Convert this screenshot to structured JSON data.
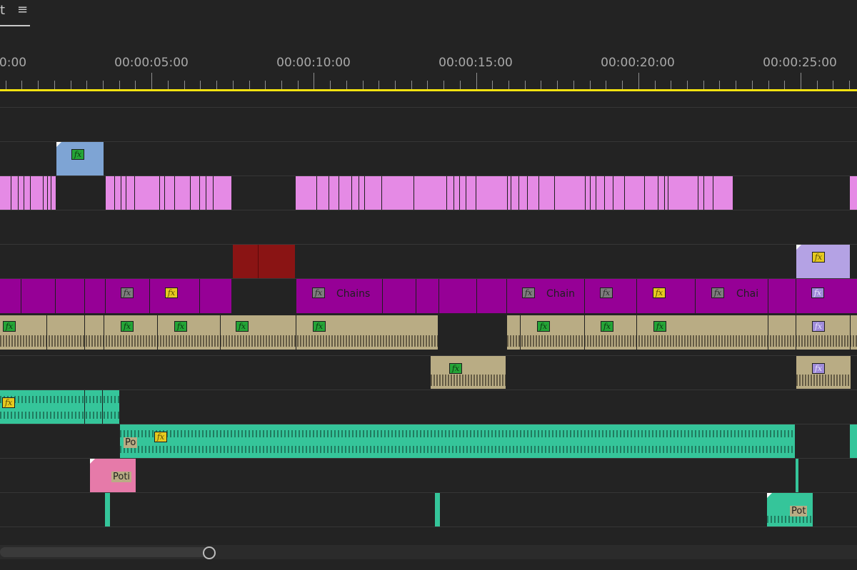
{
  "panel": {
    "tab_label": "t",
    "menu_icon": "hamburger-menu-icon"
  },
  "ruler": {
    "timecodes": [
      "0:00",
      "00:00:05:00",
      "00:00:10:00",
      "00:00:15:00",
      "00:00:20:00",
      "00:00:25:00"
    ]
  },
  "clips": {
    "fx_badge": "fx",
    "chains_1": "Chains",
    "chains_2": "Chain",
    "chains_3": "Chai",
    "audio_po": "Po",
    "audio_poti": "Poti",
    "audio_pot": "Pot"
  },
  "colors": {
    "video_purple": "#960096",
    "video_pink": "#e58ae5",
    "video_blue": "#7ea4d4",
    "video_red": "#8a1414",
    "video_lavender": "#b4a2e4",
    "audio_tan": "#b9ac84",
    "audio_green": "#35c59a",
    "audio_rose": "#e67aa9",
    "work_area_yellow": "#f5e20f"
  }
}
